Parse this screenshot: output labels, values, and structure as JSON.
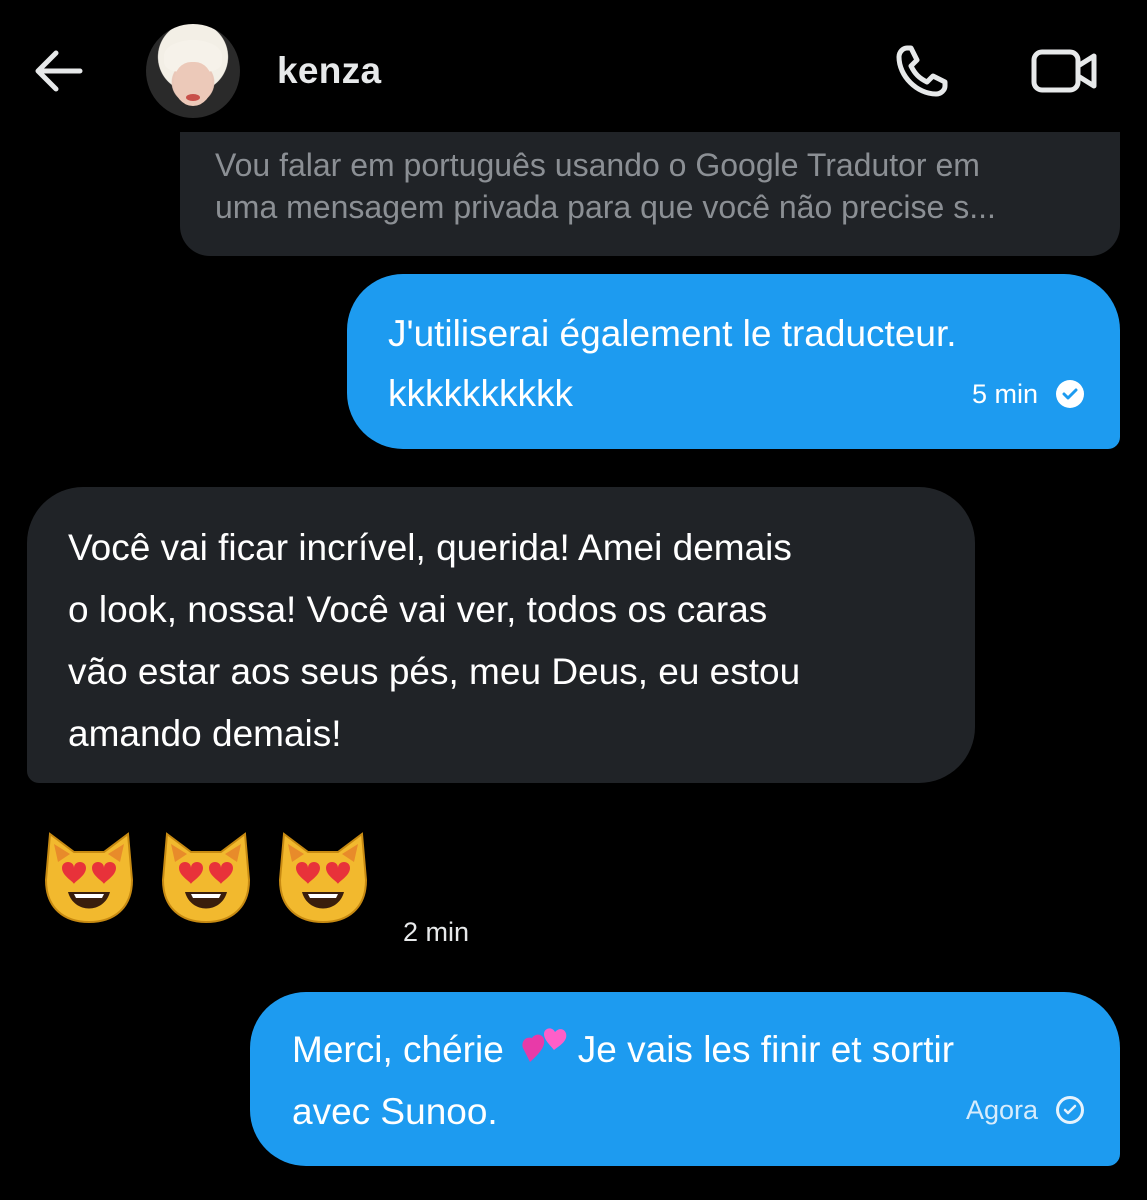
{
  "header": {
    "contact_name": "kenza",
    "back_icon": "arrow-left-icon",
    "call_icon": "phone-icon",
    "video_icon": "video-camera-icon"
  },
  "messages": {
    "preview": {
      "line1": "Vou falar em português usando o Google Tradutor em",
      "line2": "uma mensagem privada para que você não precise s..."
    },
    "msg1": {
      "line1": "J'utiliserai également le traducteur.",
      "line2": "kkkkkkkkkk",
      "time": "5 min"
    },
    "msg2": {
      "line1": "Você vai ficar incrível, querida! Amei demais",
      "line2": "o look, nossa! Você vai ver, todos os caras",
      "line3": "vão estar aos seus pés, meu Deus, eu estou",
      "line4": "amando demais!"
    },
    "emoji_msg": {
      "emojis": [
        "smiling-cat-heart-eyes",
        "smiling-cat-heart-eyes",
        "smiling-cat-heart-eyes"
      ],
      "time": "2 min"
    },
    "msg3": {
      "line1_a": "Merci, chérie",
      "line1_b": "Je vais les finir et sortir",
      "line2": "avec Sunoo.",
      "time": "Agora"
    }
  },
  "colors": {
    "background": "#000000",
    "incoming_bubble": "#202327",
    "outgoing_bubble": "#1d9bf0"
  }
}
